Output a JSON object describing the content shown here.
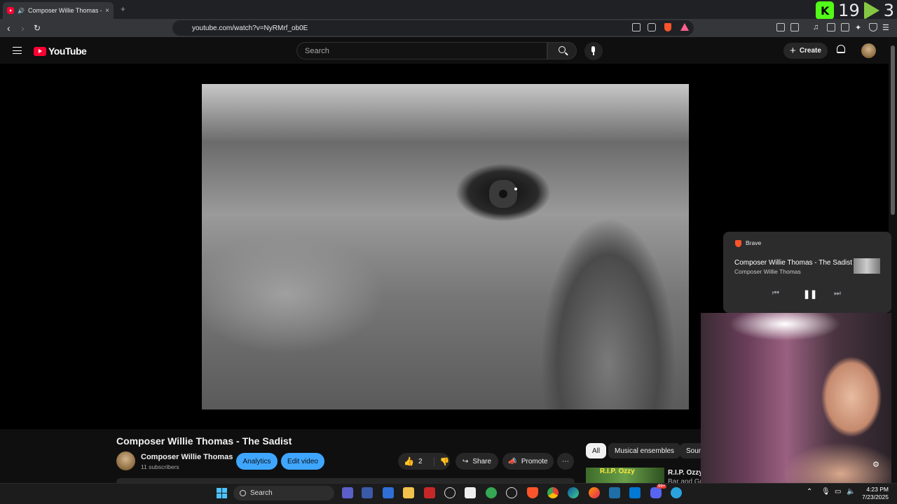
{
  "browser": {
    "tab_title": "Composer Willie Thomas - The Sadist",
    "tab_close": "×",
    "new_tab": "+",
    "url": "youtube.com/watch?v=NyRMrf_ob0E",
    "counter_kick_letter": "K",
    "counter_kick_value": "19",
    "counter_rumble_value": "3"
  },
  "header": {
    "logo_text": "YouTube",
    "search_placeholder": "Search",
    "create_label": "Create",
    "create_plus": "+"
  },
  "video": {
    "title": "Composer Willie Thomas - The Sadist",
    "channel_name": "Composer Willie Thomas",
    "subscribers": "11 subscribers",
    "analytics_label": "Analytics",
    "edit_video_label": "Edit video",
    "like_count": "2",
    "share_label": "Share",
    "promote_label": "Promote",
    "more_label": "⋯"
  },
  "chips": [
    "All",
    "Musical ensembles",
    "Soundtracks"
  ],
  "recommendation": {
    "thumb_text": "R.I.P. Ozzy",
    "title_line1": "R.I.P. Ozzy Osbourn",
    "title_line2": "Bar and Grill / Whiskey a Go G"
  },
  "media_popup": {
    "app_name": "Brave",
    "title": "Composer Willie Thomas - The Sadist",
    "channel": "Composer Willie Thomas",
    "prev": "⏮",
    "pause": "❚❚",
    "next": "⏭"
  },
  "taskbar": {
    "search_label": "Search",
    "time": "4:23 PM",
    "date": "7/23/2025",
    "badge_count": "99+"
  },
  "colors": {
    "yt_red": "#ff0033",
    "accent_blue": "#3ea6ff",
    "background": "#0f0f0f",
    "kick_green": "#53fc18",
    "rumble_green": "#85c742"
  }
}
